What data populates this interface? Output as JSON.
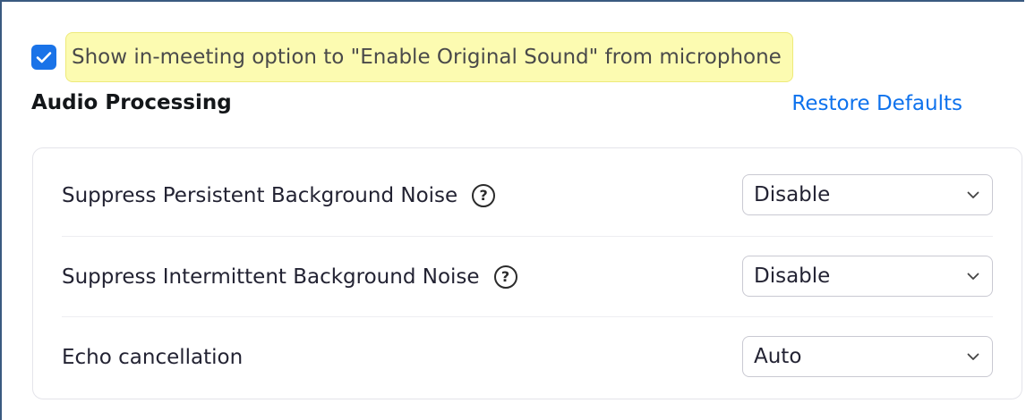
{
  "original_sound": {
    "checked": true,
    "label": "Show in-meeting option to \"Enable Original Sound\" from microphone"
  },
  "audio_processing": {
    "title": "Audio Processing",
    "restore_label": "Restore Defaults",
    "settings": [
      {
        "label": "Suppress Persistent Background Noise",
        "help": "?",
        "value": "Disable"
      },
      {
        "label": "Suppress Intermittent Background Noise",
        "help": "?",
        "value": "Disable"
      },
      {
        "label": "Echo cancellation",
        "value": "Auto"
      }
    ]
  },
  "colors": {
    "accent": "#0e72ed",
    "checkbox": "#1a73e8",
    "highlight": "#fcfbb1"
  },
  "icons": {
    "checkbox": "check-icon",
    "help": "question-circle-icon",
    "dropdown": "chevron-down-icon"
  }
}
